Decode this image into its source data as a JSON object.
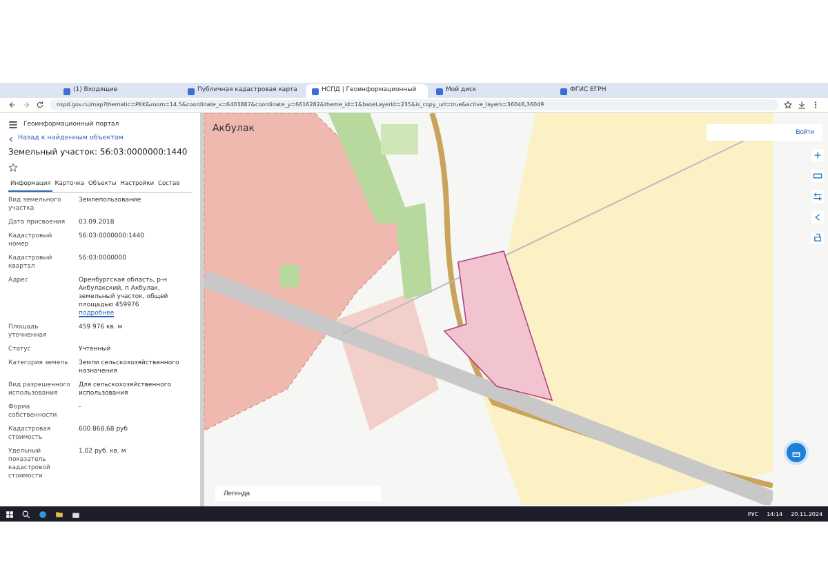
{
  "browser": {
    "tabs": [
      {
        "title": "(1) Входящие",
        "selected": false
      },
      {
        "title": "Публичная кадастровая карта",
        "selected": false
      },
      {
        "title": "НСПД | Геоинформационный",
        "selected": true
      },
      {
        "title": "Мой диск",
        "selected": false
      },
      {
        "title": "ФГИС ЕГРН",
        "selected": false
      }
    ],
    "address": "nspd.gov.ru/map?thematic=PKK&zoom=14.5&coordinate_x=6403887&coordinate_y=6616282&theme_id=1&baseLayerId=235&is_copy_url=true&active_layers=36048,36049"
  },
  "app": {
    "portal_title": "Геоинформационный портал",
    "back_link": "Назад к найденным объектам",
    "title": "Земельный участок: 56:03:0000000:1440",
    "tabs": [
      {
        "label": "Информация",
        "selected": true
      },
      {
        "label": "Карточка",
        "selected": false
      },
      {
        "label": "Объекты",
        "selected": false
      },
      {
        "label": "Настройки",
        "selected": false
      },
      {
        "label": "Состав",
        "selected": false
      }
    ],
    "rows": [
      {
        "label": "Вид земельного участка",
        "value": "Землепользование"
      },
      {
        "label": "Дата присвоения",
        "value": "03.09.2018"
      },
      {
        "label": "Кадастровый номер",
        "value": "56:03:0000000:1440"
      },
      {
        "label": "Кадастровый квартал",
        "value": "56:03:0000000"
      },
      {
        "label": "Адрес",
        "value": "Оренбургская область, р-н Акбулакский, п Акбулак, земельный участок, общей площадью 459976",
        "link": "подробнее"
      },
      {
        "label": "Площадь уточненная",
        "value": "459 976 кв. м"
      },
      {
        "label": "Статус",
        "value": "Учтенный"
      },
      {
        "label": "Категория земель",
        "value": "Земли сельскохозяйственного назначения"
      },
      {
        "label": "Вид разрешенного использования",
        "value": "Для сельскохозяйственного использования"
      },
      {
        "label": "Форма собственности",
        "value": "-"
      },
      {
        "label": "Кадастровая стоимость",
        "value": "600 868,68 руб"
      },
      {
        "label": "Удельный показатель кадастровой стоимости",
        "value": "1,02 руб. кв. м"
      }
    ]
  },
  "map": {
    "place_label": "Акбулак",
    "login": "Войти",
    "legend": "Легенда"
  },
  "taskbar": {
    "language": "РУС",
    "time": "14:14",
    "date": "20.11.2024"
  }
}
